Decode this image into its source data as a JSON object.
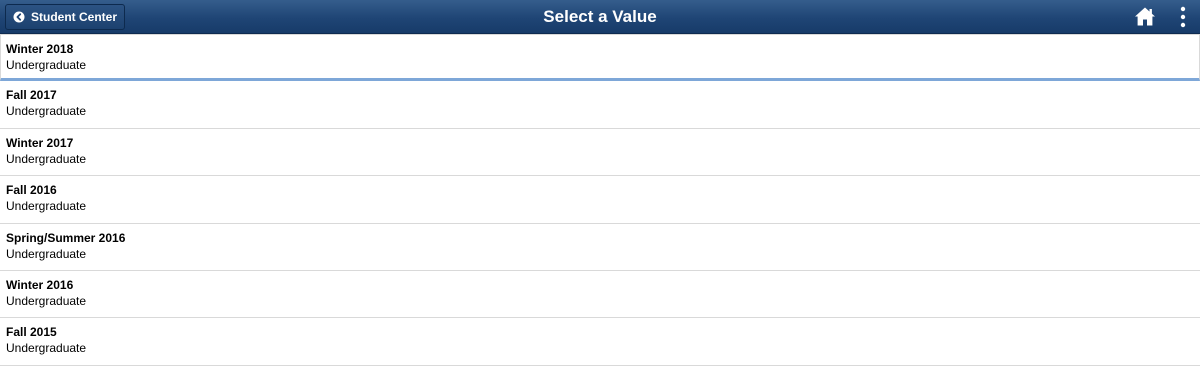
{
  "header": {
    "back_label": "Student Center",
    "title": "Select a Value",
    "home_icon": "home-icon",
    "more_icon": "more-vertical-icon"
  },
  "items": [
    {
      "term": "Winter 2018",
      "career": "Undergraduate"
    },
    {
      "term": "Fall 2017",
      "career": "Undergraduate"
    },
    {
      "term": "Winter 2017",
      "career": "Undergraduate"
    },
    {
      "term": "Fall 2016",
      "career": "Undergraduate"
    },
    {
      "term": "Spring/Summer 2016",
      "career": "Undergraduate"
    },
    {
      "term": "Winter 2016",
      "career": "Undergraduate"
    },
    {
      "term": "Fall 2015",
      "career": "Undergraduate"
    }
  ],
  "colors": {
    "header_top": "#355d8c",
    "header_bottom": "#173b69",
    "selected_underline": "#7ea7d8",
    "divider": "#d9d9d9"
  }
}
